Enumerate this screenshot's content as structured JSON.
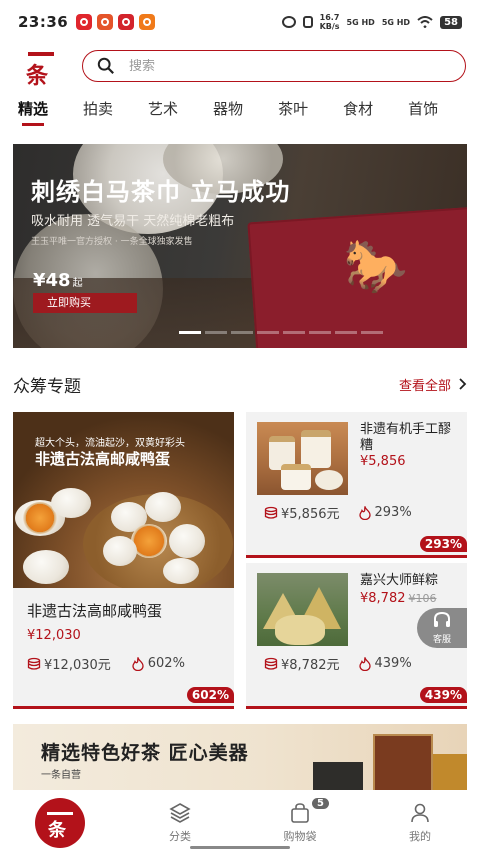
{
  "status": {
    "time": "23:36",
    "net_speed": "16.7",
    "net_unit": "KB/s",
    "sig1": "5G HD",
    "sig2": "5G HD",
    "battery": "58"
  },
  "header": {
    "logo_text": "条",
    "search_placeholder": "搜索"
  },
  "tabs": [
    "精选",
    "拍卖",
    "艺术",
    "器物",
    "茶叶",
    "食材",
    "首饰"
  ],
  "banner": {
    "title": "刺绣白马茶巾 立马成功",
    "subtitle": "吸水耐用  透气易干  天然纯棉老粗布",
    "note": "王玉平唯一官方授权 · 一条全球独家发售",
    "price": "¥48",
    "price_suffix": "起",
    "cta": "立即购买"
  },
  "section": {
    "title": "众筹专题",
    "more": "查看全部"
  },
  "big_card": {
    "img_annotation": "超大个头，流油起沙，双黄好彩头",
    "img_title": "非遗古法高邮咸鸭蛋",
    "name": "非遗古法高邮咸鸭蛋",
    "price": "¥12,030",
    "raised": "¥12,030元",
    "pct": "602%",
    "pct_badge": "602%"
  },
  "cards": [
    {
      "name": "非遗有机手工醪糟",
      "price": "¥5,856",
      "original_price": "",
      "raised": "¥5,856元",
      "pct": "293%",
      "pct_badge": "293%"
    },
    {
      "name": "嘉兴大师鲜粽",
      "price": "¥8,782",
      "original_price": "¥106",
      "raised": "¥8,782元",
      "pct": "439%",
      "pct_badge": "439%"
    }
  ],
  "service_label": "客服",
  "promo": {
    "title": "精选特色好茶 匠心美器",
    "subtitle": "一条自营"
  },
  "nav": {
    "home": "条",
    "category": "分类",
    "cart": "购物袋",
    "cart_badge": "5",
    "me": "我的"
  },
  "colors": {
    "brand": "#b3121a",
    "card_bg": "#f2f2f2"
  }
}
